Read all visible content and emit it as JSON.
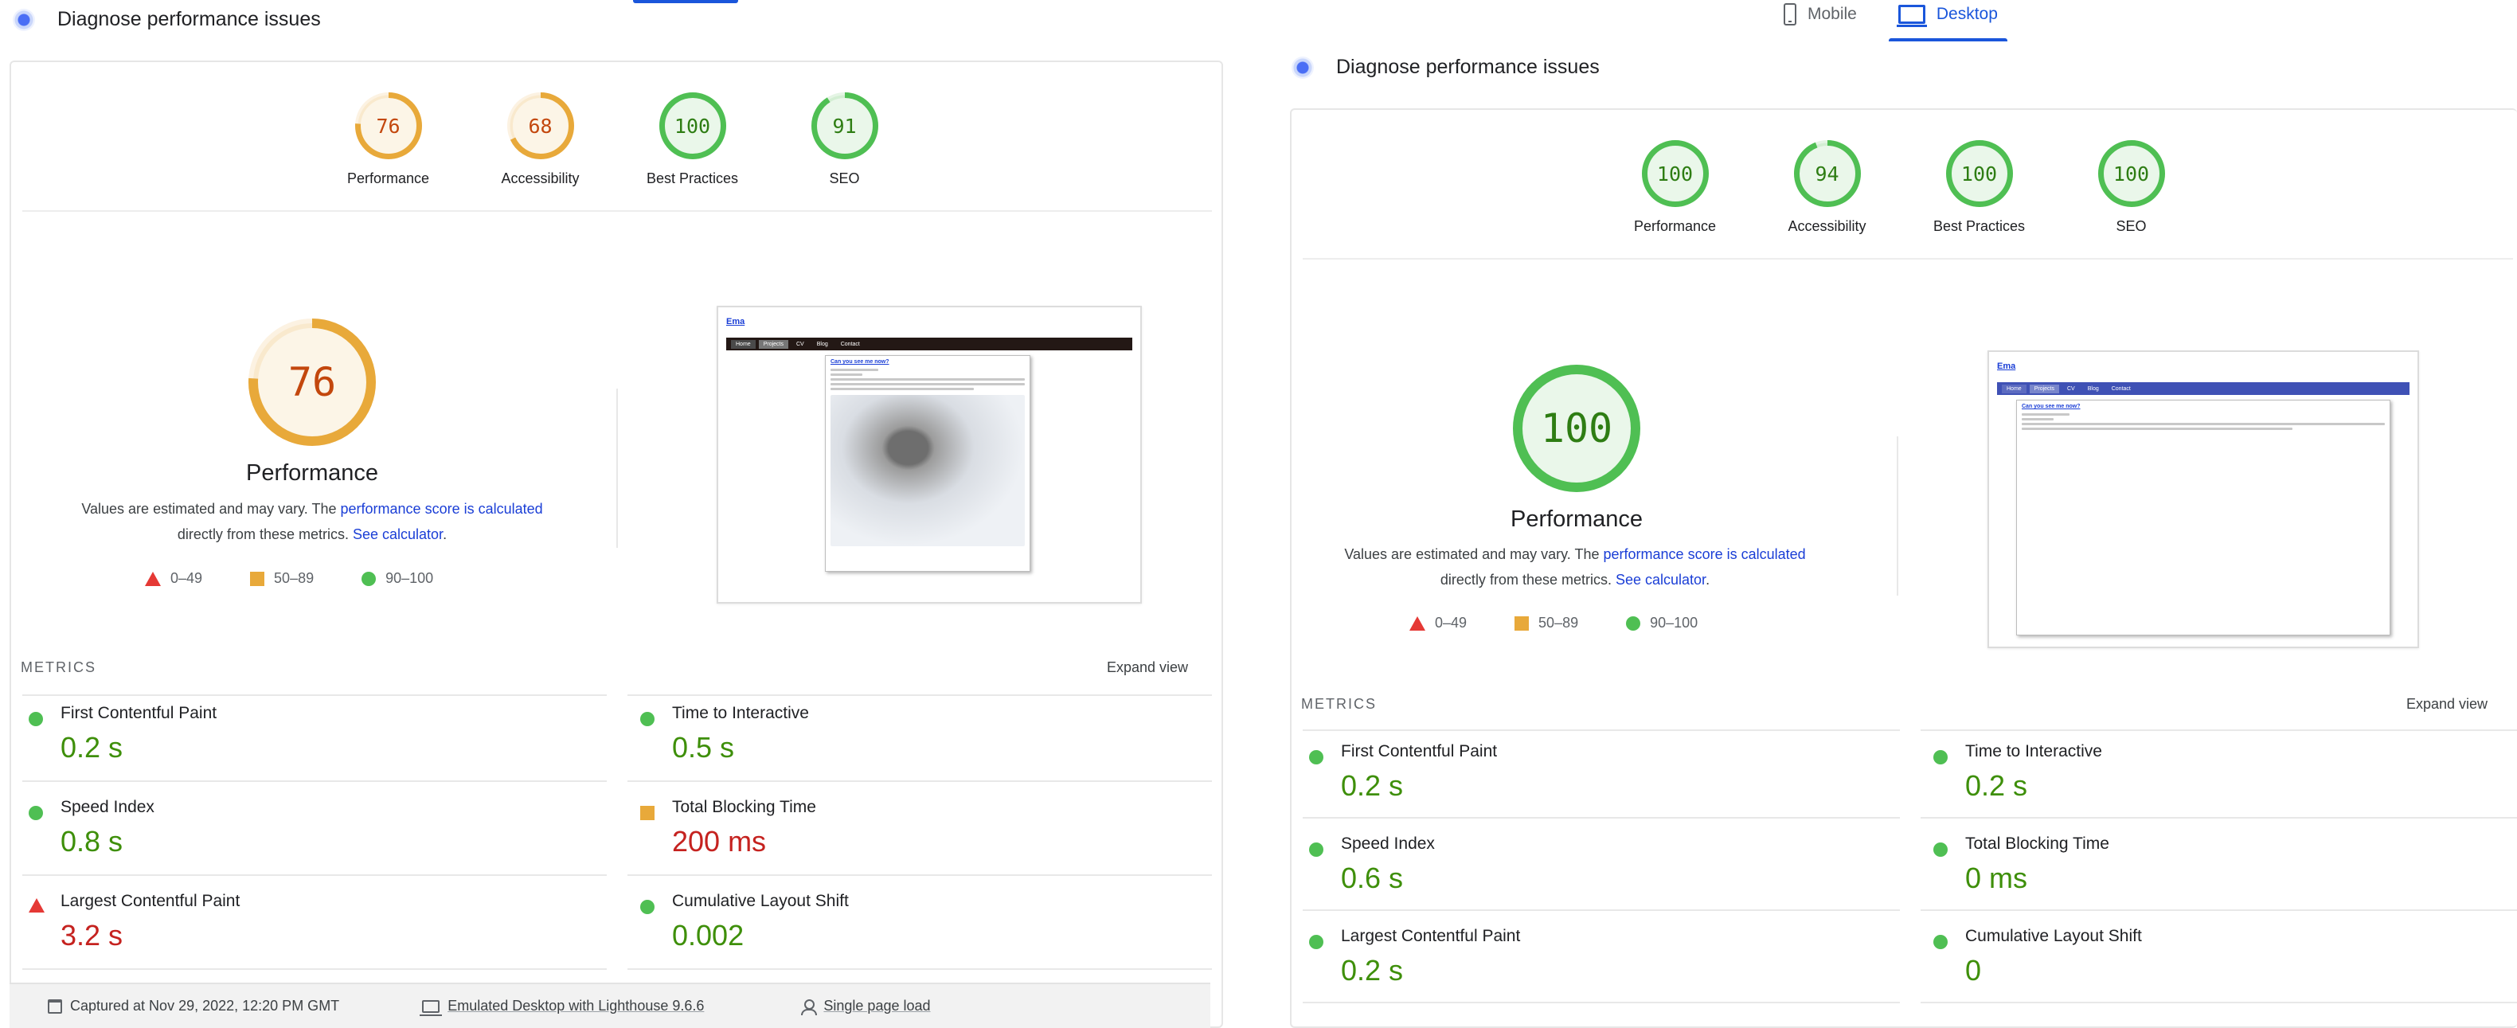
{
  "left": {
    "title": "Diagnose performance issues",
    "gauges": [
      {
        "label": "Performance",
        "score": "76",
        "value": 76,
        "color": "#e8a93a",
        "num_color": "#c3470d"
      },
      {
        "label": "Accessibility",
        "score": "68",
        "value": 68,
        "color": "#e8a93a",
        "num_color": "#c3470d"
      },
      {
        "label": "Best Practices",
        "score": "100",
        "value": 100,
        "color": "#4fbf53",
        "num_color": "#2e7d13"
      },
      {
        "label": "SEO",
        "score": "91",
        "value": 91,
        "color": "#4fbf53",
        "num_color": "#2e7d13"
      }
    ],
    "big_score": "76",
    "big_value": 76,
    "big_color": "#e8a93a",
    "big_num_color": "#c3470d",
    "big_label": "Performance",
    "desc": {
      "pre": "Values are estimated and may vary. The ",
      "link1": "performance score is calculated",
      "mid": "directly from these metrics. ",
      "link2": "See calculator",
      "post": "."
    },
    "legend": [
      "0–49",
      "50–89",
      "90–100"
    ],
    "thumb": {
      "site": "Ema",
      "nav": [
        "Home",
        "Projects",
        "CV",
        "Blog",
        "Contact"
      ],
      "nav_color": "#231815",
      "article_title": "Can you see me now?"
    },
    "metrics_label": "METRICS",
    "expand_label": "Expand view",
    "metrics": [
      {
        "name": "First Contentful Paint",
        "value": "0.2 s",
        "status": "good"
      },
      {
        "name": "Time to Interactive",
        "value": "0.5 s",
        "status": "good"
      },
      {
        "name": "Speed Index",
        "value": "0.8 s",
        "status": "good"
      },
      {
        "name": "Total Blocking Time",
        "value": "200 ms",
        "status": "average"
      },
      {
        "name": "Largest Contentful Paint",
        "value": "3.2 s",
        "status": "poor"
      },
      {
        "name": "Cumulative Layout Shift",
        "value": "0.002",
        "status": "good"
      }
    ],
    "runtime": {
      "captured": "Captured at Nov 29, 2022, 12:20 PM GMT",
      "device": "Emulated Desktop with Lighthouse 9.6.6",
      "load": "Single page load"
    }
  },
  "right": {
    "tabs": {
      "mobile": "Mobile",
      "desktop": "Desktop"
    },
    "title": "Diagnose performance issues",
    "gauges": [
      {
        "label": "Performance",
        "score": "100",
        "value": 100,
        "color": "#4fbf53",
        "num_color": "#2e7d13"
      },
      {
        "label": "Accessibility",
        "score": "94",
        "value": 94,
        "color": "#4fbf53",
        "num_color": "#2e7d13"
      },
      {
        "label": "Best Practices",
        "score": "100",
        "value": 100,
        "color": "#4fbf53",
        "num_color": "#2e7d13"
      },
      {
        "label": "SEO",
        "score": "100",
        "value": 100,
        "color": "#4fbf53",
        "num_color": "#2e7d13"
      }
    ],
    "big_score": "100",
    "big_value": 100,
    "big_color": "#4fbf53",
    "big_num_color": "#2e7d13",
    "big_label": "Performance",
    "desc": {
      "pre": "Values are estimated and may vary. The ",
      "link1": "performance score is calculated",
      "mid": "directly from these metrics. ",
      "link2": "See calculator",
      "post": "."
    },
    "legend": [
      "0–49",
      "50–89",
      "90–100"
    ],
    "thumb": {
      "site": "Ema",
      "nav": [
        "Home",
        "Projects",
        "CV",
        "Blog",
        "Contact"
      ],
      "nav_color": "#3f51b5",
      "article_title": "Can you see me now?"
    },
    "metrics_label": "METRICS",
    "expand_label": "Expand view",
    "metrics": [
      {
        "name": "First Contentful Paint",
        "value": "0.2 s",
        "status": "good"
      },
      {
        "name": "Time to Interactive",
        "value": "0.2 s",
        "status": "good"
      },
      {
        "name": "Speed Index",
        "value": "0.6 s",
        "status": "good"
      },
      {
        "name": "Total Blocking Time",
        "value": "0 ms",
        "status": "good"
      },
      {
        "name": "Largest Contentful Paint",
        "value": "0.2 s",
        "status": "good"
      },
      {
        "name": "Cumulative Layout Shift",
        "value": "0",
        "status": "good"
      }
    ]
  }
}
